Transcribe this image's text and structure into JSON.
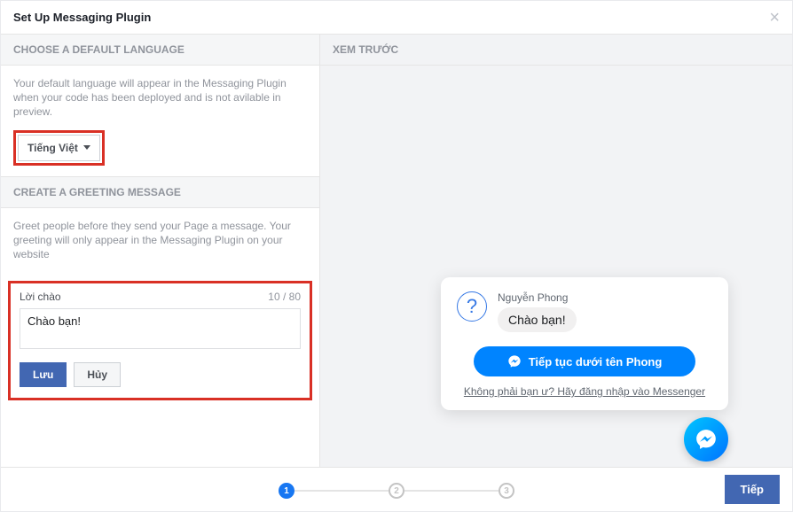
{
  "dialog": {
    "title": "Set Up Messaging Plugin"
  },
  "left": {
    "lang_section_header": "CHOOSE A DEFAULT LANGUAGE",
    "lang_help": "Your default language will appear in the Messaging Plugin when your code has been deployed and is not avilable in preview.",
    "lang_selected": "Tiếng Việt",
    "greeting_section_header": "CREATE A GREETING MESSAGE",
    "greeting_help": "Greet people before they send your Page a message. Your greeting will only appear in the Messaging Plugin on your website",
    "greeting_label": "Lời chào",
    "greeting_counter": "10 / 80",
    "greeting_value": "Chào bạn!",
    "save_label": "Lưu",
    "cancel_label": "Hủy"
  },
  "right": {
    "preview_header": "XEM TRƯỚC",
    "user_name": "Nguyễn Phong",
    "bubble_text": "Chào bạn!",
    "continue_label": "Tiếp tục dưới tên Phong",
    "not_you_text": "Không phải bạn ư? Hãy đăng nhập vào Messenger"
  },
  "footer": {
    "steps": [
      "1",
      "2",
      "3"
    ],
    "active_step": 1,
    "next_label": "Tiếp"
  }
}
